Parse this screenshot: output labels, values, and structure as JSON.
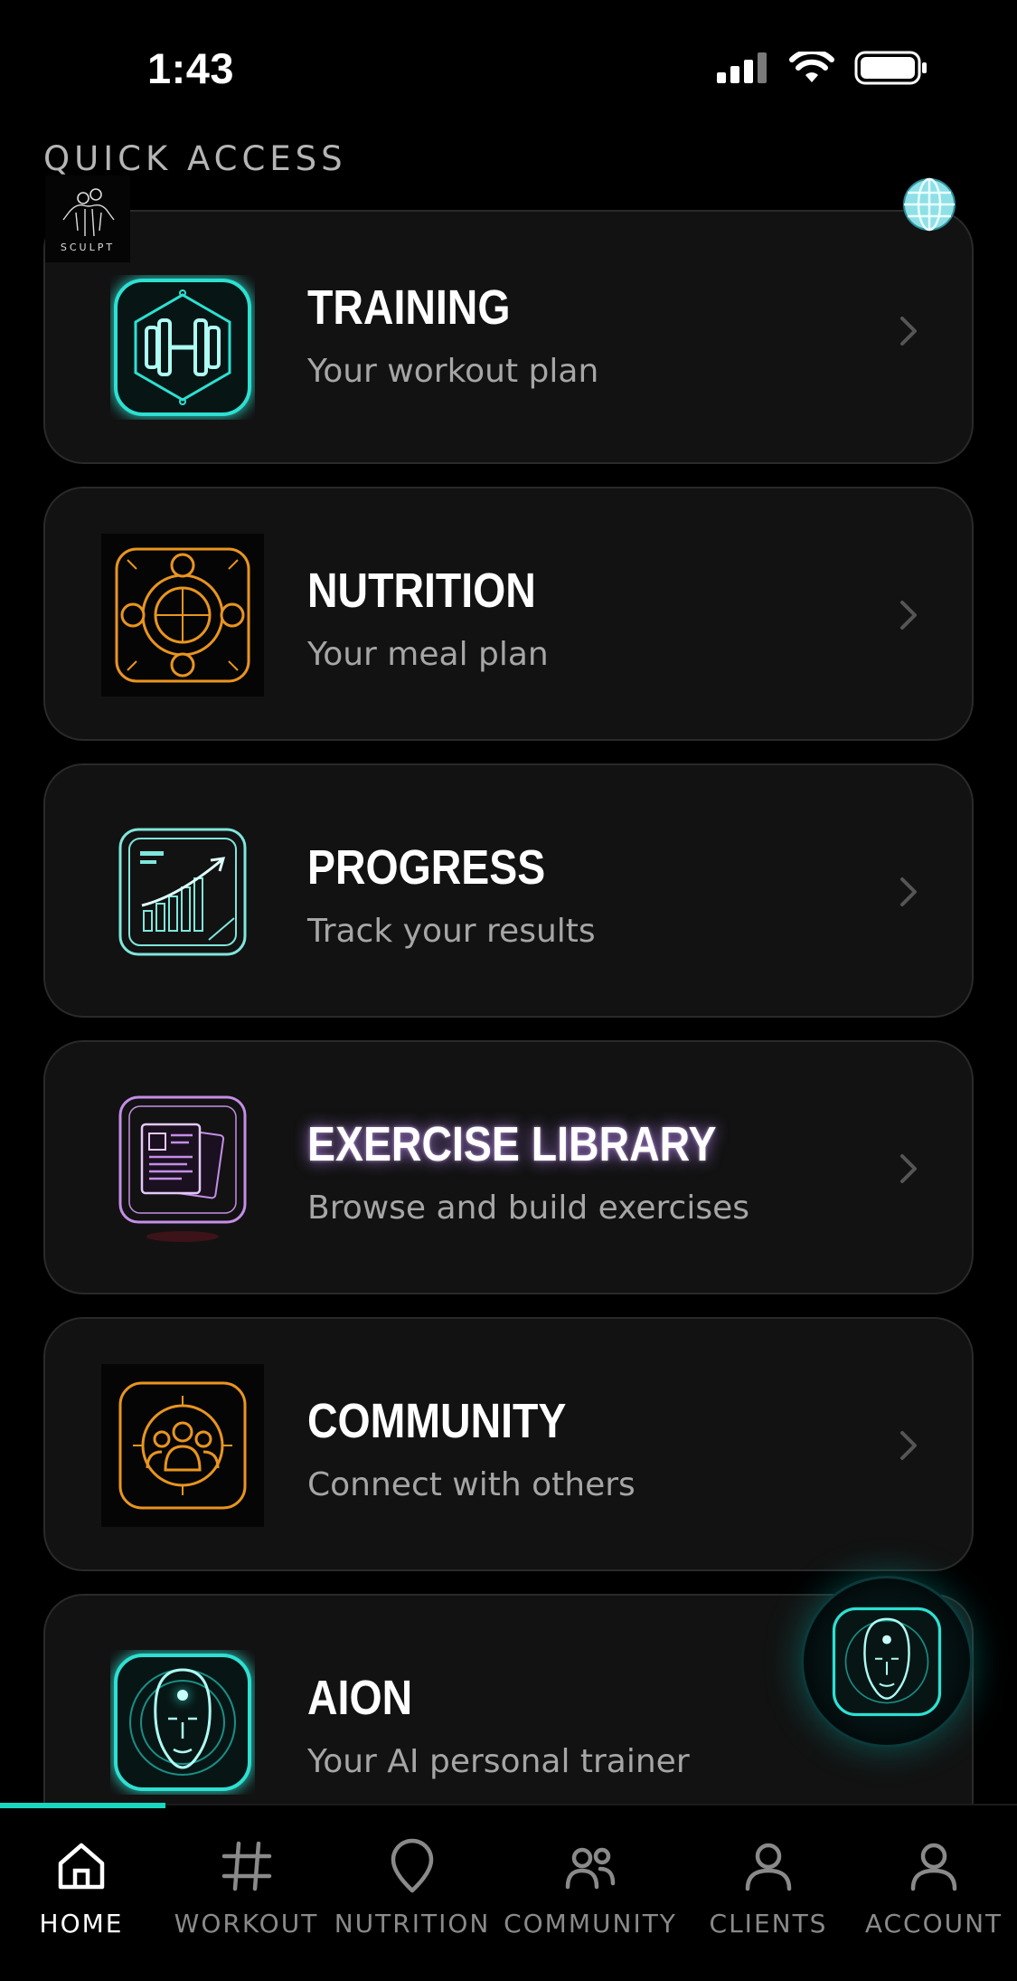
{
  "status_bar": {
    "time": "1:43"
  },
  "header": {
    "section_label": "QUICK ACCESS",
    "logo_text": "SCULPT"
  },
  "cards": [
    {
      "title": "TRAINING",
      "subtitle": "Your workout plan",
      "icon": "dumbbell-icon"
    },
    {
      "title": "NUTRITION",
      "subtitle": "Your meal plan",
      "icon": "nutrition-icon"
    },
    {
      "title": "PROGRESS",
      "subtitle": "Track your results",
      "icon": "progress-chart-icon"
    },
    {
      "title": "EXERCISE LIBRARY",
      "subtitle": "Browse and build exercises",
      "icon": "library-icon"
    },
    {
      "title": "COMMUNITY",
      "subtitle": "Connect with others",
      "icon": "community-icon"
    },
    {
      "title": "AION",
      "subtitle": "Your AI personal trainer",
      "icon": "ai-face-icon"
    }
  ],
  "bottom_nav": {
    "items": [
      {
        "label": "HOME",
        "icon": "home-icon",
        "active": true
      },
      {
        "label": "WORKOUT",
        "icon": "hash-icon",
        "active": false
      },
      {
        "label": "NUTRITION",
        "icon": "leaf-icon",
        "active": false
      },
      {
        "label": "COMMUNITY",
        "icon": "users-icon",
        "active": false
      },
      {
        "label": "CLIENTS",
        "icon": "user-icon",
        "active": false
      },
      {
        "label": "ACCOUNT",
        "icon": "user-icon",
        "active": false
      }
    ]
  },
  "colors": {
    "accent": "#19d6c0",
    "card_bg": "#121212",
    "teal_icon": "#2de0d2",
    "orange_icon": "#e9951f",
    "purple_icon": "#c48ee6"
  }
}
